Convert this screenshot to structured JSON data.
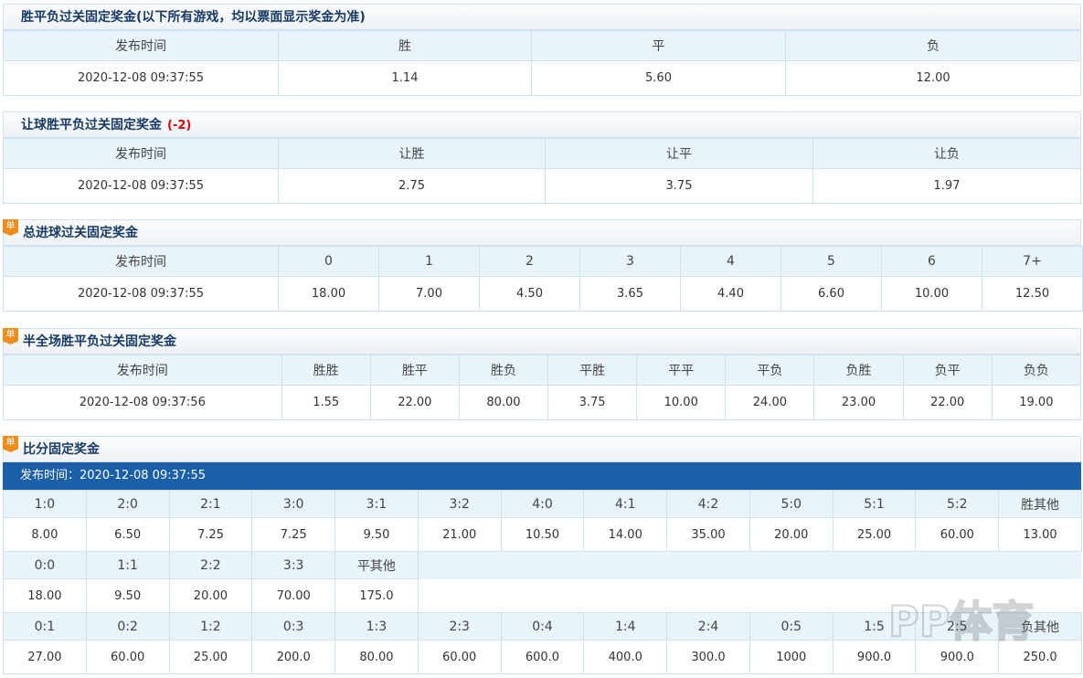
{
  "had": {
    "title": "胜平负过关固定奖金(以下所有游戏，均以票面显示奖金为准)",
    "headers": [
      "发布时间",
      "胜",
      "平",
      "负"
    ],
    "values": [
      "2020-12-08 09:37:55",
      "1.14",
      "5.60",
      "12.00"
    ]
  },
  "hhad": {
    "title": "让球胜平负过关固定奖金",
    "handicap": "(-2)",
    "headers": [
      "发布时间",
      "让胜",
      "让平",
      "让负"
    ],
    "values": [
      "2020-12-08 09:37:55",
      "2.75",
      "3.75",
      "1.97"
    ]
  },
  "ttg": {
    "badge": "单",
    "title": "总进球过关固定奖金",
    "headers": [
      "发布时间",
      "0",
      "1",
      "2",
      "3",
      "4",
      "5",
      "6",
      "7+"
    ],
    "values": [
      "2020-12-08 09:37:55",
      "18.00",
      "7.00",
      "4.50",
      "3.65",
      "4.40",
      "6.60",
      "10.00",
      "12.50"
    ]
  },
  "hafu": {
    "badge": "单",
    "title": "半全场胜平负过关固定奖金",
    "headers": [
      "发布时间",
      "胜胜",
      "胜平",
      "胜负",
      "平胜",
      "平平",
      "平负",
      "负胜",
      "负平",
      "负负"
    ],
    "values": [
      "2020-12-08 09:37:56",
      "1.55",
      "22.00",
      "80.00",
      "3.75",
      "10.00",
      "24.00",
      "23.00",
      "22.00",
      "19.00"
    ]
  },
  "crs": {
    "badge": "单",
    "title": "比分固定奖金",
    "publish": "发布时间：2020-12-08 09:37:55",
    "win_headers": [
      "1:0",
      "2:0",
      "2:1",
      "3:0",
      "3:1",
      "3:2",
      "4:0",
      "4:1",
      "4:2",
      "5:0",
      "5:1",
      "5:2",
      "胜其他"
    ],
    "win_values": [
      "8.00",
      "6.50",
      "7.25",
      "7.25",
      "9.50",
      "21.00",
      "10.50",
      "14.00",
      "35.00",
      "20.00",
      "25.00",
      "60.00",
      "13.00"
    ],
    "draw_headers": [
      "0:0",
      "1:1",
      "2:2",
      "3:3",
      "平其他"
    ],
    "draw_values": [
      "18.00",
      "9.50",
      "20.00",
      "70.00",
      "175.0"
    ],
    "lose_headers": [
      "0:1",
      "0:2",
      "1:2",
      "0:3",
      "1:3",
      "2:3",
      "0:4",
      "1:4",
      "2:4",
      "0:5",
      "1:5",
      "2:5",
      "负其他"
    ],
    "lose_values": [
      "27.00",
      "60.00",
      "25.00",
      "200.0",
      "80.00",
      "60.00",
      "600.0",
      "400.0",
      "300.0",
      "1000",
      "900.0",
      "900.0",
      "250.0"
    ]
  },
  "watermark": {
    "text": "PP体育"
  }
}
